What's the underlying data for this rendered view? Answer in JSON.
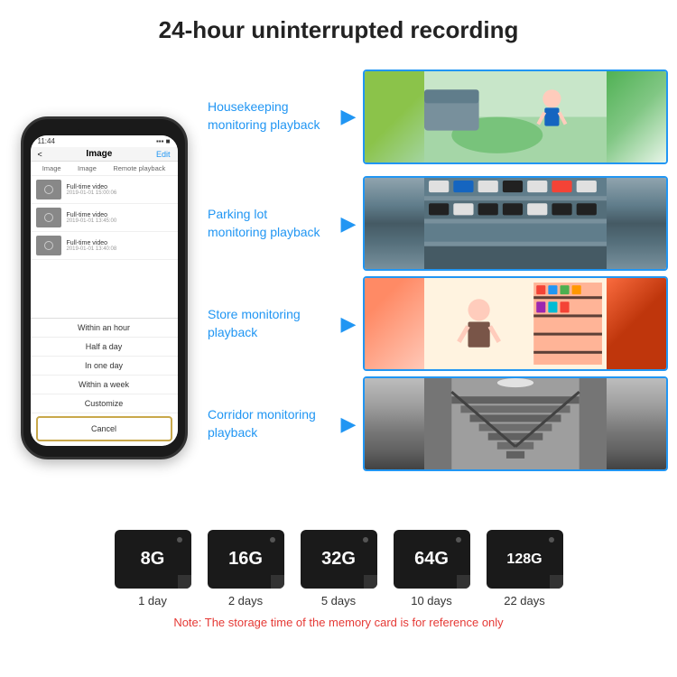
{
  "header": {
    "title": "24-hour uninterrupted recording"
  },
  "phone": {
    "time": "11:44",
    "screen_title": "Image",
    "edit_label": "Edit",
    "tabs": [
      "Image",
      "Image",
      "Remote playback"
    ],
    "back_label": "<",
    "list_items": [
      {
        "title": "Full-time video",
        "date": "2019-01-01 15:00:06"
      },
      {
        "title": "Full-time video",
        "date": "2019-01-01 13:45:00"
      },
      {
        "title": "Full-time video",
        "date": "2019-01-01 13:40:08"
      }
    ],
    "dropdown_items": [
      "Within an hour",
      "Half a day",
      "In one day",
      "Within a week",
      "Customize"
    ],
    "cancel_label": "Cancel"
  },
  "monitoring": [
    {
      "label": "Housekeeping\nmonitoring playback",
      "image_type": "housekeeping"
    },
    {
      "label": "Parking lot\nmonitoring playback",
      "image_type": "parking"
    },
    {
      "label": "Store monitoring\nplayback",
      "image_type": "store"
    },
    {
      "label": "Corridor monitoring\nplayback",
      "image_type": "corridor"
    }
  ],
  "sd_cards": [
    {
      "size": "8G",
      "days": "1 day"
    },
    {
      "size": "16G",
      "days": "2 days"
    },
    {
      "size": "32G",
      "days": "5 days"
    },
    {
      "size": "64G",
      "days": "10 days"
    },
    {
      "size": "128G",
      "days": "22 days"
    }
  ],
  "note": {
    "text": "Note: The storage time of the memory card is for reference only"
  }
}
